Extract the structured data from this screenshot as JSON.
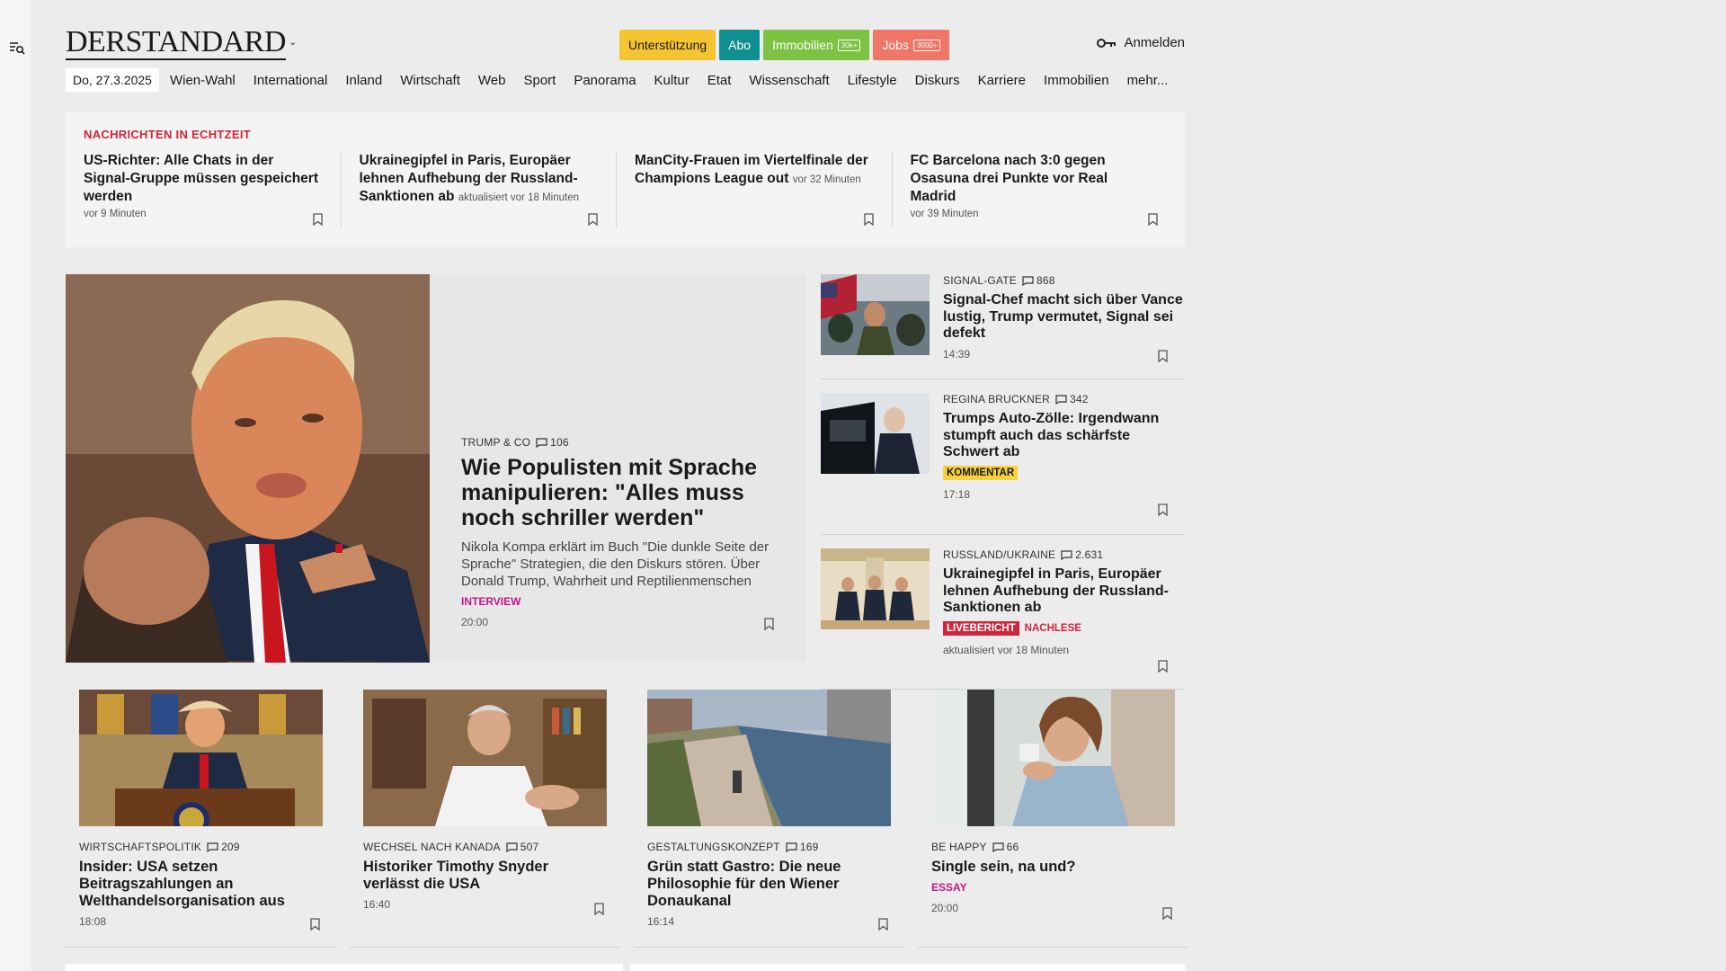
{
  "header": {
    "logo": "DERSTANDARD",
    "pills": [
      {
        "label": "Unterstützung",
        "bg": "#f5c531",
        "fg": "#1a1a1a",
        "tag": ""
      },
      {
        "label": "Abo",
        "bg": "#0f8f8f",
        "fg": "#ffffff",
        "tag": ""
      },
      {
        "label": "Immobilien",
        "bg": "#7dc242",
        "fg": "#ffffff",
        "tag": "30k+"
      },
      {
        "label": "Jobs",
        "bg": "#f07667",
        "fg": "#ffffff",
        "tag": "3000+"
      }
    ],
    "login": "Anmelden"
  },
  "nav": {
    "date": "Do, 27.3.2025",
    "items": [
      "Wien-Wahl",
      "International",
      "Inland",
      "Wirtschaft",
      "Web",
      "Sport",
      "Panorama",
      "Kultur",
      "Etat",
      "Wissenschaft",
      "Lifestyle",
      "Diskurs",
      "Karriere",
      "Immobilien",
      "mehr..."
    ]
  },
  "realtime": {
    "label": "NACHRICHTEN IN ECHTZEIT",
    "items": [
      {
        "title": "US-Richter: Alle Chats in der Signal-Gruppe müssen gespeichert werden",
        "time": "vor 9 Minuten"
      },
      {
        "title": "Ukrainegipfel in Paris, Europäer lehnen Aufhebung der Russland-Sanktionen ab",
        "time": "aktualisiert vor 18 Minuten"
      },
      {
        "title": "ManCity-Frauen im Viertelfinale der Champions League out",
        "time": "vor 32 Minuten"
      },
      {
        "title": "FC Barcelona nach 3:0 gegen Osasuna drei Punkte vor Real Madrid",
        "time": "vor 39 Minuten"
      }
    ]
  },
  "lead": {
    "kicker": "TRUMP & CO",
    "comments": "106",
    "title": "Wie Populisten mit Sprache manipulieren: \"Alles muss noch schriller werden\"",
    "desc": "Nikola Kompa erklärt im Buch \"Die dunkle Seite der Sprache\" Strategien, die den Diskurs stören. Über Donald Trump, Wahrheit und Reptilienmenschen",
    "flag": "INTERVIEW",
    "time": "20:00"
  },
  "side": [
    {
      "kicker": "SIGNAL-GATE",
      "comments": "868",
      "title": "Signal-Chef macht sich über Vance lustig, Trump vermutet, Signal sei defekt",
      "time": "14:39"
    },
    {
      "kicker": "REGINA BRUCKNER",
      "comments": "342",
      "title": "Trumps Auto-Zölle: Irgendwann stumpft auch das schärfste Schwert ab",
      "badge": "KOMMENTAR",
      "time": "17:18"
    },
    {
      "kicker": "RUSSLAND/UKRAINE",
      "comments": "2.631",
      "title": "Ukrainegipfel in Paris, Europäer lehnen Aufhebung der Russland-Sanktionen ab",
      "badge": "LIVEBERICHT",
      "badge2": "NACHLESE",
      "time": "aktualisiert vor 18 Minuten"
    }
  ],
  "cards": [
    {
      "kicker": "WIRTSCHAFTSPOLITIK",
      "comments": "209",
      "title": "Insider: USA setzen Beitragszahlungen an Welthandelsorganisation aus",
      "time": "18:08"
    },
    {
      "kicker": "WECHSEL NACH KANADA",
      "comments": "507",
      "title": "Historiker Timothy Snyder verlässt die USA",
      "time": "16:40"
    },
    {
      "kicker": "GESTALTUNGSKONZEPT",
      "comments": "169",
      "title": "Grün statt Gastro: Die neue Philosophie für den Wiener Donaukanal",
      "time": "16:14"
    },
    {
      "kicker": "BE HAPPY",
      "comments": "66",
      "title": "Single sein, na und?",
      "flag": "ESSAY",
      "time": "20:00"
    }
  ]
}
